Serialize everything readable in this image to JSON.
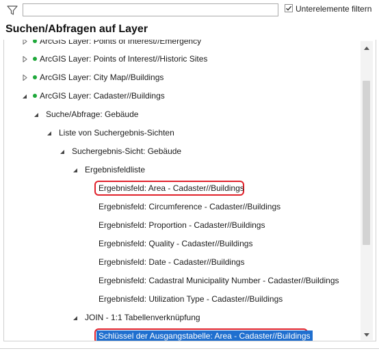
{
  "toolbar": {
    "filter_icon": "funnel-icon",
    "search_value": "",
    "search_placeholder": "",
    "checkbox_checked": true,
    "checkbox_label": "Unterelemente filtern"
  },
  "panel": {
    "title": "Suchen/Abfragen auf Layer"
  },
  "tree": {
    "rows": [
      {
        "label": "ArcGIS Layer: Points of Interest//Emergency",
        "expanded": false,
        "dot": true
      },
      {
        "label": "ArcGIS Layer: Points of Interest//Historic Sites",
        "expanded": false,
        "dot": true
      },
      {
        "label": "ArcGIS Layer: City Map//Buildings",
        "expanded": false,
        "dot": true
      },
      {
        "label": "ArcGIS Layer: Cadaster//Buildings",
        "expanded": true,
        "dot": true
      },
      {
        "label": "Suche/Abfrage: Gebäude",
        "expanded": true,
        "dot": false
      },
      {
        "label": "Liste von Suchergebnis-Sichten",
        "expanded": true,
        "dot": false
      },
      {
        "label": "Suchergebnis-Sicht: Gebäude",
        "expanded": true,
        "dot": false
      },
      {
        "label": "Ergebnisfeldliste",
        "expanded": true,
        "dot": false
      },
      {
        "label": "Ergebnisfeld: Area - Cadaster//Buildings",
        "highlighted": true
      },
      {
        "label": "Ergebnisfeld: Circumference - Cadaster//Buildings"
      },
      {
        "label": "Ergebnisfeld: Proportion - Cadaster//Buildings"
      },
      {
        "label": "Ergebnisfeld: Quality - Cadaster//Buildings"
      },
      {
        "label": "Ergebnisfeld: Date - Cadaster//Buildings"
      },
      {
        "label": "Ergebnisfeld: Cadastral Municipality Number - Cadaster//Buildings"
      },
      {
        "label": "Ergebnisfeld: Utilization Type - Cadaster//Buildings"
      },
      {
        "label": "JOIN - 1:1 Tabellenverknüpfung",
        "expanded": true,
        "dot": false
      },
      {
        "label": "Schlüssel der Ausgangstabelle: Area - Cadaster//Buildings",
        "highlighted": true,
        "selected": true
      }
    ]
  },
  "colors": {
    "status_dot": "#1ea83a",
    "highlight_border": "#e0202a",
    "selection": "#1f6fcf"
  }
}
